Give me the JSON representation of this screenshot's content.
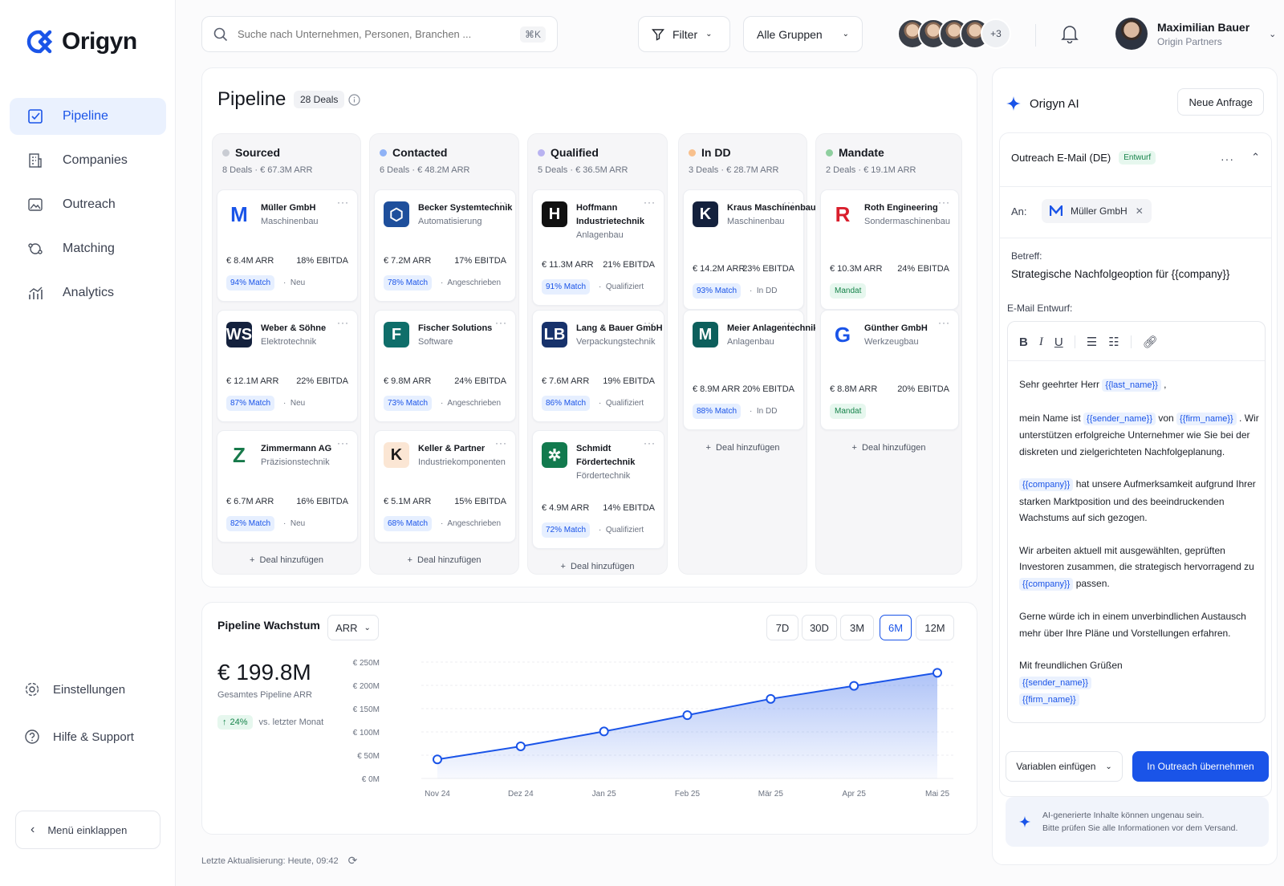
{
  "app": {
    "name": "Origyn"
  },
  "sidebar": {
    "items": [
      {
        "label": "Pipeline",
        "icon": "pipeline-icon"
      },
      {
        "label": "Companies",
        "icon": "building-icon"
      },
      {
        "label": "Outreach",
        "icon": "outreach-icon"
      },
      {
        "label": "Matching",
        "icon": "matching-icon"
      },
      {
        "label": "Analytics",
        "icon": "analytics-icon"
      }
    ],
    "settings": "Einstellungen",
    "help": "Hilfe & Support",
    "collapse": "Menü einklappen"
  },
  "topbar": {
    "search_placeholder": "Suche nach Unternehmen, Personen, Branchen ...",
    "shortcut": "⌘K",
    "filter": "Filter",
    "group": "Alle Gruppen",
    "more_avatars": "+3",
    "user_name": "Maximilian Bauer",
    "user_org": "Origin Partners"
  },
  "pipeline": {
    "title": "Pipeline",
    "badge": "28 Deals",
    "add_deal": "Deal hinzufügen",
    "columns": [
      {
        "name": "Sourced",
        "summary": "8 Deals · € 67.3M ARR",
        "color": "#c9ccd3",
        "cards": [
          {
            "name": "Müller GmbH",
            "industry": "Maschinenbau",
            "arr": "€ 8.4M ARR",
            "ebitda": "18% EBITDA",
            "match": "94% Match",
            "status": "Neu"
          },
          {
            "name": "Weber & Söhne",
            "industry": "Elektrotechnik",
            "arr": "€ 12.1M ARR",
            "ebitda": "22% EBITDA",
            "match": "87% Match",
            "status": "Neu"
          },
          {
            "name": "Zimmermann AG",
            "industry": "Präzisionstechnik",
            "arr": "€ 6.7M ARR",
            "ebitda": "16% EBITDA",
            "match": "82% Match",
            "status": "Neu"
          }
        ]
      },
      {
        "name": "Contacted",
        "summary": "6 Deals · € 48.2M ARR",
        "color": "#8fb2f6",
        "cards": [
          {
            "name": "Becker Systemtechnik",
            "industry": "Automatisierung",
            "arr": "€ 7.2M ARR",
            "ebitda": "17% EBITDA",
            "match": "78% Match",
            "status": "Angeschrieben"
          },
          {
            "name": "Fischer Solutions",
            "industry": "Software",
            "arr": "€ 9.8M ARR",
            "ebitda": "24% EBITDA",
            "match": "73% Match",
            "status": "Angeschrieben"
          },
          {
            "name": "Keller & Partner",
            "industry": "Industriekomponenten",
            "arr": "€ 5.1M ARR",
            "ebitda": "15% EBITDA",
            "match": "68% Match",
            "status": "Angeschrieben"
          }
        ]
      },
      {
        "name": "Qualified",
        "summary": "5 Deals · € 36.5M ARR",
        "color": "#b9b3f1",
        "cards": [
          {
            "name": "Hoffmann Industrietechnik",
            "industry": "Anlagenbau",
            "arr": "€ 11.3M ARR",
            "ebitda": "21% EBITDA",
            "match": "91% Match",
            "status": "Qualifiziert"
          },
          {
            "name": "Lang & Bauer GmbH",
            "industry": "Verpackungstechnik",
            "arr": "€ 7.6M ARR",
            "ebitda": "19% EBITDA",
            "match": "86% Match",
            "status": "Qualifiziert"
          },
          {
            "name": "Schmidt Fördertechnik",
            "industry": "Fördertechnik",
            "arr": "€ 4.9M ARR",
            "ebitda": "14% EBITDA",
            "match": "72% Match",
            "status": "Qualifiziert"
          }
        ]
      },
      {
        "name": "In DD",
        "summary": "3 Deals · € 28.7M ARR",
        "color": "#f8c08d",
        "cards": [
          {
            "name": "Kraus Maschinenbau",
            "industry": "Maschinenbau",
            "arr": "€ 14.2M ARR",
            "ebitda": "23% EBITDA",
            "match": "93% Match",
            "status": "In DD"
          },
          {
            "name": "Meier Anlagentechnik",
            "industry": "Anlagenbau",
            "arr": "€ 8.9M ARR",
            "ebitda": "20% EBITDA",
            "match": "88% Match",
            "status": "In DD"
          }
        ]
      },
      {
        "name": "Mandate",
        "summary": "2 Deals · € 19.1M ARR",
        "color": "#8fcf9f",
        "cards": [
          {
            "name": "Roth Engineering",
            "industry": "Sondermaschinenbau",
            "arr": "€ 10.3M ARR",
            "ebitda": "24% EBITDA",
            "badge": "Mandat"
          },
          {
            "name": "Günther GmbH",
            "industry": "Werkzeugbau",
            "arr": "€ 8.8M ARR",
            "ebitda": "20% EBITDA",
            "badge": "Mandat"
          }
        ]
      }
    ]
  },
  "growth": {
    "title": "Pipeline Wachstum",
    "metric": "ARR",
    "ranges": [
      "7D",
      "30D",
      "3M",
      "6M",
      "12M"
    ],
    "active_range": "6M",
    "total": "€ 199.8M",
    "total_label": "Gesamtes Pipeline ARR",
    "change": "24%",
    "change_label": "vs. letzter Monat",
    "updated": "Letzte Aktualisierung: Heute, 09:42"
  },
  "chart_data": {
    "type": "area",
    "x": [
      "Nov 24",
      "Dez 24",
      "Jan 25",
      "Feb 25",
      "Mär 25",
      "Apr 25",
      "Mai 25"
    ],
    "values": [
      41,
      69,
      101,
      136,
      171,
      199,
      227
    ],
    "y_ticks": [
      "€ 0M",
      "€ 50M",
      "€ 100M",
      "€ 150M",
      "€ 200M",
      "€ 250M"
    ],
    "ylim": [
      0,
      250
    ],
    "grid": true,
    "color": "#1a54e8"
  },
  "ai": {
    "title": "Origyn AI",
    "new_request": "Neue Anfrage",
    "mail_title": "Outreach E-Mail (DE)",
    "draft": "Entwurf",
    "to_label": "An:",
    "recipient": "Müller GmbH",
    "subject_label": "Betreff:",
    "subject": "Strategische Nachfolgeoption für {{company}}",
    "body_label": "E-Mail Entwurf:",
    "body": {
      "greet": "Sehr geehrter Herr",
      "v_last": "{{last_name}}",
      "p1a": "mein Name ist",
      "v_sender": "{{sender_name}}",
      "p1b": "von",
      "v_firm": "{{firm_name}}",
      "p1c": "Wir unterstützen erfolgreiche Unternehmer wie Sie bei der diskreten und zielgerichteten Nachfolgeplanung.",
      "v_company": "{{company}}",
      "p2": "hat unsere Aufmerksamkeit aufgrund Ihrer starken Marktposition und des beeindruckenden Wachstums auf sich gezogen.",
      "p3": "Wir arbeiten aktuell mit ausgewählten, geprüften Investoren zusammen, die strategisch hervorragend",
      "p3b": "zu",
      "p3c": "passen.",
      "p4": "Gerne würde ich in einem unverbindlichen Austausch mehr über Ihre Pläne und Vorstellungen erfahren.",
      "closing": "Mit freundlichen Grüßen"
    },
    "insert_vars": "Variablen einfügen",
    "apply": "In Outreach übernehmen",
    "disclaimer1": "AI-generierte Inhalte können ungenau sein.",
    "disclaimer2": "Bitte prüfen Sie alle Informationen vor dem Versand."
  }
}
